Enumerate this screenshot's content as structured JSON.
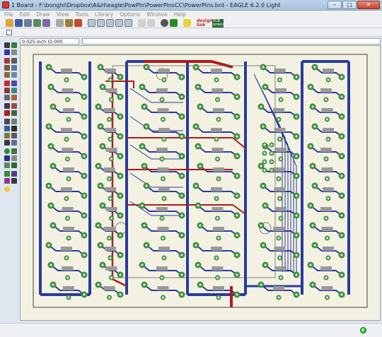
{
  "window": {
    "title": "1 Board - F:\\bonghi\\Dropbox\\A&H\\eagle\\PowPin\\PowerPinsCC\\PowerPins.brd - EAGLE 6.2.0 Light",
    "minimize_glyph": "–",
    "maximize_glyph": "□",
    "close_glyph": "✕"
  },
  "menu": {
    "items": [
      "File",
      "Edit",
      "Draw",
      "View",
      "Tools",
      "Library",
      "Options",
      "Window",
      "Help"
    ]
  },
  "toolbar": {
    "design_link_label": "design link",
    "pcb_orders_label": "PCB orders"
  },
  "coordinates": {
    "value": "0.025 inch (0.000 2.750)"
  },
  "colors": {
    "board_bg": "#f2f1e2",
    "top_trace": "#b01a1a",
    "bottom_trace": "#2a3a9c",
    "pad": "#3f8f3f",
    "pad_hole": "#dde8dd",
    "outline": "#404040"
  }
}
